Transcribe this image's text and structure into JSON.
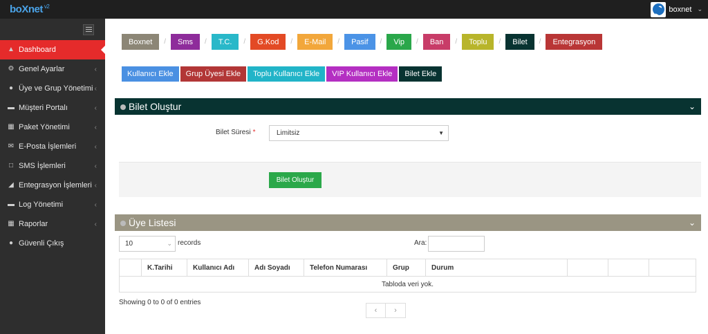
{
  "app": {
    "logo_main": "bo",
    "logo_x": "X",
    "logo_end": "net",
    "logo_version": "v2",
    "username": "boxnet"
  },
  "sidebar": {
    "items": [
      {
        "label": "Dashboard",
        "icon": "dashboard-icon"
      },
      {
        "label": "Genel Ayarlar",
        "icon": "cogs-icon"
      },
      {
        "label": "Üye ve Grup Yönetimi",
        "icon": "user-icon"
      },
      {
        "label": "Müşteri Portalı",
        "icon": "folder-icon"
      },
      {
        "label": "Paket Yönetimi",
        "icon": "table-icon"
      },
      {
        "label": "E-Posta İşlemleri",
        "icon": "envelope-icon"
      },
      {
        "label": "SMS İşlemleri",
        "icon": "sms-icon"
      },
      {
        "label": "Entegrasyon İşlemleri",
        "icon": "sitemap-icon"
      },
      {
        "label": "Log Yönetimi",
        "icon": "folder-open-icon"
      },
      {
        "label": "Raporlar",
        "icon": "grid-icon"
      },
      {
        "label": "Güvenli Çıkış",
        "icon": "user-icon"
      }
    ]
  },
  "tabs": [
    {
      "label": "Boxnet",
      "color": "#8c8676"
    },
    {
      "label": "Sms",
      "color": "#8e2c9b"
    },
    {
      "label": "T.C.",
      "color": "#29b8c9"
    },
    {
      "label": "G.Kod",
      "color": "#e34a25"
    },
    {
      "label": "E-Mail",
      "color": "#f2a73b"
    },
    {
      "label": "Pasif",
      "color": "#4b93e6"
    },
    {
      "label": "Vip",
      "color": "#2aa74a"
    },
    {
      "label": "Ban",
      "color": "#c83c68"
    },
    {
      "label": "Toplu",
      "color": "#b8b52b"
    },
    {
      "label": "Bilet",
      "color": "#083331"
    },
    {
      "label": "Entegrasyon",
      "color": "#b93636"
    }
  ],
  "subtabs": [
    {
      "label": "Kullanıcı Ekle",
      "color": "#4a90e2"
    },
    {
      "label": "Grup Üyesi Ekle",
      "color": "#b23636"
    },
    {
      "label": "Toplu Kullanıcı Ekle",
      "color": "#21b4c8"
    },
    {
      "label": "VIP Kullanıcı Ekle",
      "color": "#b42fc2"
    },
    {
      "label": "Bilet Ekle",
      "color": "#083331"
    }
  ],
  "ticket_panel": {
    "title": "Bilet Oluştur",
    "color": "#083331",
    "field_label": "Bilet Süresi",
    "required_mark": "*",
    "field_value": "Limitsiz",
    "submit_label": "Bilet Oluştur"
  },
  "members_panel": {
    "title": "Üye Listesi",
    "color": "#9a9583",
    "page_length": "10",
    "records_label": "records",
    "search_label": "Ara:",
    "columns": [
      "",
      "K.Tarihi",
      "Kullanıcı Adı",
      "Adı Soyadı",
      "Telefon Numarası",
      "Grup",
      "Durum",
      "",
      "",
      ""
    ],
    "empty_text": "Tabloda veri yok.",
    "info": "Showing 0 to 0 of 0 entries",
    "prev": "‹",
    "next": "›"
  }
}
